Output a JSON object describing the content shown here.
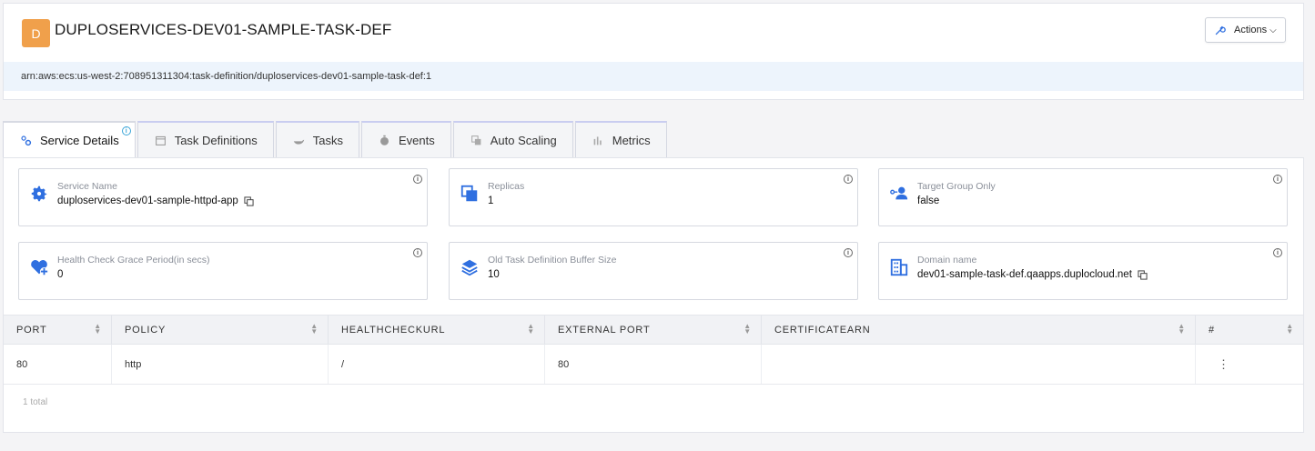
{
  "header": {
    "avatar_letter": "D",
    "title": "DUPLOSERVICES-DEV01-SAMPLE-TASK-DEF",
    "actions_label": "Actions",
    "arn": "arn:aws:ecs:us-west-2:708951311304:task-definition/duploservices-dev01-sample-task-def:1"
  },
  "tabs": [
    {
      "label": "Service Details",
      "icon": "gears-icon",
      "active": true
    },
    {
      "label": "Task Definitions",
      "icon": "calendar-icon"
    },
    {
      "label": "Tasks",
      "icon": "docker-icon"
    },
    {
      "label": "Events",
      "icon": "stopwatch-icon"
    },
    {
      "label": "Auto Scaling",
      "icon": "copy-stack-icon"
    },
    {
      "label": "Metrics",
      "icon": "bar-chart-icon"
    }
  ],
  "cards": {
    "service_name": {
      "label": "Service Name",
      "value": "duploservices-dev01-sample-httpd-app"
    },
    "replicas": {
      "label": "Replicas",
      "value": "1"
    },
    "target_group_only": {
      "label": "Target Group Only",
      "value": "false"
    },
    "health_check": {
      "label": "Health Check Grace Period(in secs)",
      "value": "0"
    },
    "old_task_buffer": {
      "label": "Old Task Definition Buffer Size",
      "value": "10"
    },
    "domain_name": {
      "label": "Domain name",
      "value": "dev01-sample-task-def.qaapps.duplocloud.net"
    }
  },
  "table": {
    "columns": [
      "PORT",
      "POLICY",
      "HEALTHCHECKURL",
      "EXTERNAL PORT",
      "CERTIFICATEARN",
      "#"
    ],
    "rows": [
      [
        "80",
        "http",
        "/",
        "80",
        ""
      ]
    ],
    "total": "1 total"
  },
  "colors": {
    "accent_blue": "#2f6fe0",
    "avatar_orange": "#f0a04b",
    "arn_bg": "#edf4fc"
  }
}
